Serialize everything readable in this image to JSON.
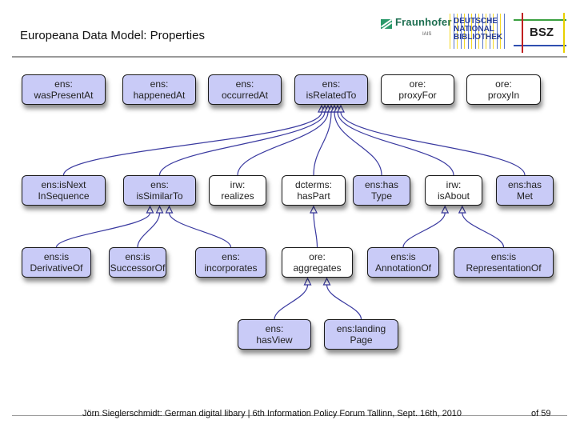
{
  "slide": {
    "title": "Europeana Data Model: Properties",
    "footer": "Jörn Sieglerschmidt: German digital libary | 6th Information Policy Forum Tallinn, Sept. 16th, 2010",
    "page": "of 59"
  },
  "logos": {
    "fraunhofer": "Fraunhofer",
    "fraunhofer_sub": "IAIS",
    "dnb_lines": [
      "DEUTSCHE",
      "NATIONAL",
      "BIBLIOTHEK"
    ],
    "bsz": "BSZ"
  },
  "colors": {
    "ens_fill": "#c9cbf7",
    "other_fill": "#ffffff",
    "edge": "#3a3aa0"
  },
  "nodes": [
    {
      "id": "wasPresentAt",
      "prefix": "ens:",
      "name": "wasPresentAt",
      "style": "ens"
    },
    {
      "id": "happenedAt",
      "prefix": "ens:",
      "name": "happenedAt",
      "style": "ens"
    },
    {
      "id": "occurredAt",
      "prefix": "ens:",
      "name": "occurredAt",
      "style": "ens"
    },
    {
      "id": "isRelatedTo",
      "prefix": "ens:",
      "name": "isRelatedTo",
      "style": "ens"
    },
    {
      "id": "proxyFor",
      "prefix": "ore:",
      "name": "proxyFor",
      "style": "white"
    },
    {
      "id": "proxyIn",
      "prefix": "ore:",
      "name": "proxyIn",
      "style": "white"
    },
    {
      "id": "isNextInSequence",
      "prefix": "ens:isNext",
      "name": "InSequence",
      "style": "ens"
    },
    {
      "id": "isSimilarTo",
      "prefix": "ens:",
      "name": "isSimilarTo",
      "style": "ens"
    },
    {
      "id": "realizes",
      "prefix": "irw:",
      "name": "realizes",
      "style": "white"
    },
    {
      "id": "hasPart",
      "prefix": "dcterms:",
      "name": "hasPart",
      "style": "white"
    },
    {
      "id": "hasType",
      "prefix": "ens:has",
      "name": "Type",
      "style": "ens"
    },
    {
      "id": "isAbout",
      "prefix": "irw:",
      "name": "isAbout",
      "style": "white"
    },
    {
      "id": "hasMet",
      "prefix": "ens:has",
      "name": "Met",
      "style": "ens"
    },
    {
      "id": "isDerivativeOf",
      "prefix": "ens:is",
      "name": "DerivativeOf",
      "style": "ens"
    },
    {
      "id": "isSuccessorOf",
      "prefix": "ens:is",
      "name": "SuccessorOf",
      "style": "ens"
    },
    {
      "id": "incorporates",
      "prefix": "ens:",
      "name": "incorporates",
      "style": "ens"
    },
    {
      "id": "aggregates",
      "prefix": "ore:",
      "name": "aggregates",
      "style": "white"
    },
    {
      "id": "isAnnotationOf",
      "prefix": "ens:is",
      "name": "AnnotationOf",
      "style": "ens"
    },
    {
      "id": "isRepresentationOf",
      "prefix": "ens:is",
      "name": "RepresentationOf",
      "style": "ens"
    },
    {
      "id": "hasView",
      "prefix": "ens:",
      "name": "hasView",
      "style": "ens"
    },
    {
      "id": "landingPage",
      "prefix": "ens:landing",
      "name": "Page",
      "style": "ens"
    }
  ],
  "edges": [
    {
      "from": "isNextInSequence",
      "to": "isRelatedTo"
    },
    {
      "from": "isSimilarTo",
      "to": "isRelatedTo"
    },
    {
      "from": "realizes",
      "to": "isRelatedTo"
    },
    {
      "from": "hasPart",
      "to": "isRelatedTo"
    },
    {
      "from": "hasType",
      "to": "isRelatedTo"
    },
    {
      "from": "isAbout",
      "to": "isRelatedTo"
    },
    {
      "from": "hasMet",
      "to": "isRelatedTo"
    },
    {
      "from": "isDerivativeOf",
      "to": "isSimilarTo"
    },
    {
      "from": "isSuccessorOf",
      "to": "isSimilarTo"
    },
    {
      "from": "incorporates",
      "to": "isSimilarTo"
    },
    {
      "from": "aggregates",
      "to": "hasPart"
    },
    {
      "from": "isAnnotationOf",
      "to": "isAbout"
    },
    {
      "from": "isRepresentationOf",
      "to": "isAbout"
    },
    {
      "from": "hasView",
      "to": "aggregates"
    },
    {
      "from": "landingPage",
      "to": "aggregates"
    }
  ]
}
